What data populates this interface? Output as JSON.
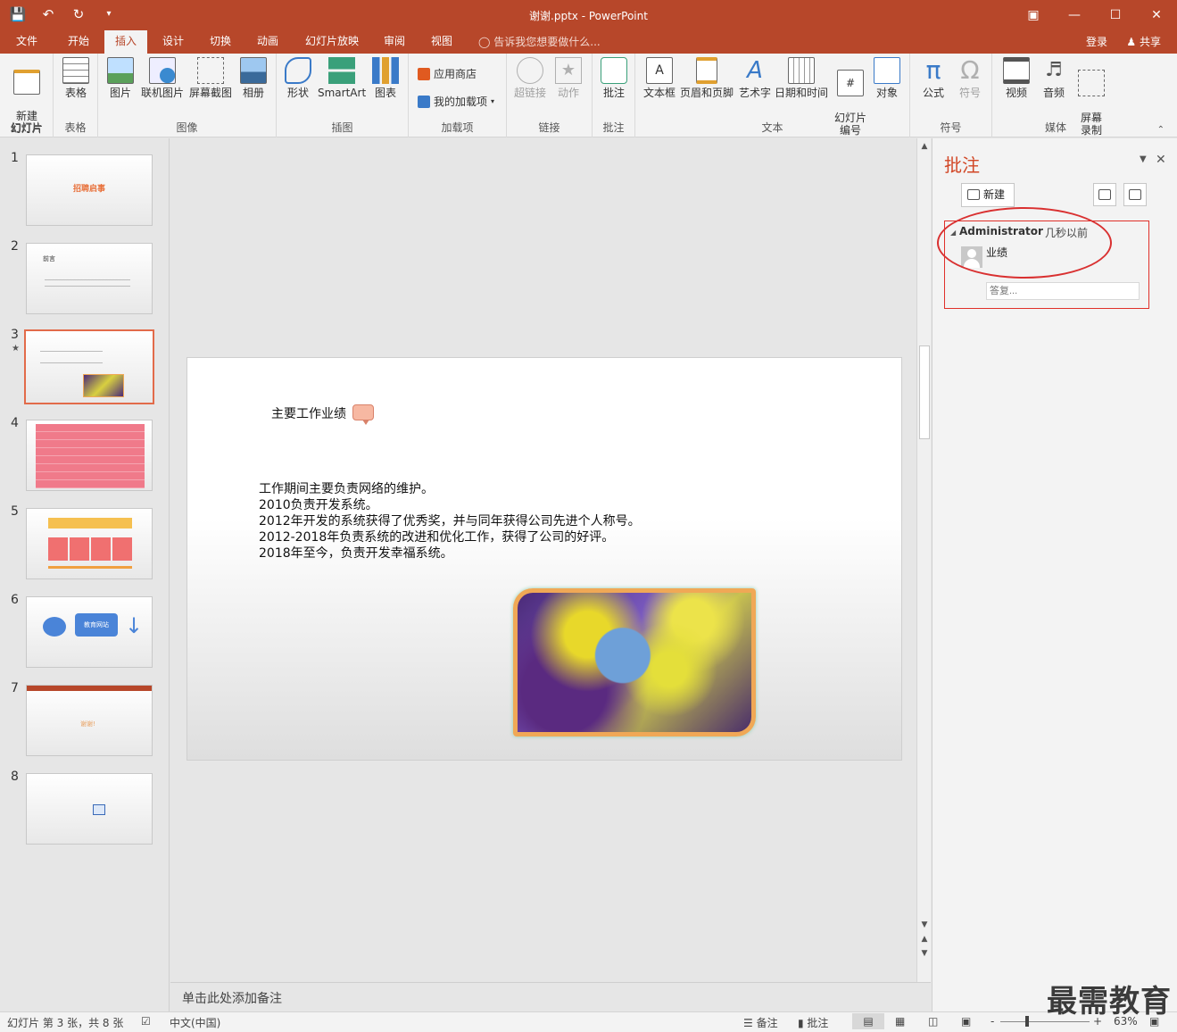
{
  "window": {
    "title": "谢谢.pptx - PowerPoint"
  },
  "tabs": [
    "文件",
    "开始",
    "插入",
    "设计",
    "切换",
    "动画",
    "幻灯片放映",
    "审阅",
    "视图"
  ],
  "active_tab": "插入",
  "tellme": "告诉我您想要做什么...",
  "account": {
    "login": "登录",
    "share": "共享"
  },
  "ribbon": {
    "groups": {
      "slides": "幻灯片",
      "tables": "表格",
      "images": "图像",
      "illustrations": "插图",
      "addins": "加载项",
      "links": "链接",
      "comments": "批注",
      "text": "文本",
      "symbols": "符号",
      "media": "媒体"
    },
    "buttons": {
      "new_slide": "新建\n幻灯片",
      "table": "表格",
      "picture": "图片",
      "online_picture": "联机图片",
      "screenshot": "屏幕截图",
      "album": "相册",
      "shapes": "形状",
      "smartart": "SmartArt",
      "chart": "图表",
      "store": "应用商店",
      "my_addins": "我的加载项",
      "hyperlink": "超链接",
      "action": "动作",
      "comment": "批注",
      "textbox": "文本框",
      "header_footer": "页眉和页脚",
      "wordart": "艺术字",
      "datetime": "日期和时间",
      "slide_number": "幻灯片\n编号",
      "object": "对象",
      "equation": "公式",
      "symbol": "符号",
      "video": "视频",
      "audio": "音频",
      "screen_recording": "屏幕\n录制"
    }
  },
  "thumbnails": {
    "numbers": [
      "1",
      "2",
      "3",
      "4",
      "5",
      "6",
      "7",
      "8"
    ],
    "selected": 3,
    "t1_title": "招聘启事",
    "t2_title": "前言",
    "t6_label": "教育网站",
    "t7_label": "谢谢!"
  },
  "slide": {
    "title": "主要工作业绩",
    "lines": [
      "工作期间主要负责网络的维护。",
      "2010负责开发系统。",
      "2012年开发的系统获得了优秀奖，并与同年获得公司先进个人称号。",
      "2012-2018年负责系统的改进和优化工作，获得了公司的好评。",
      "2018年至今，负责开发幸福系统。"
    ]
  },
  "notes_placeholder": "单击此处添加备注",
  "comments_pane": {
    "title": "批注",
    "new_label": "新建",
    "comment": {
      "author": "Administrator",
      "time": "几秒以前",
      "text": "业绩",
      "reply_placeholder": "答复..."
    }
  },
  "status": {
    "slide_info": "幻灯片 第 3 张，共 8 张",
    "language": "中文(中国)",
    "notes": "备注",
    "comments": "批注",
    "zoom_minus": "-",
    "zoom_plus": "+",
    "zoom": "63%",
    "zoom_fraction": 0.3
  },
  "watermark": "最需教育",
  "colors": {
    "accent": "#b7472a",
    "pane_title": "#d24726",
    "highlight": "#e0302a"
  }
}
